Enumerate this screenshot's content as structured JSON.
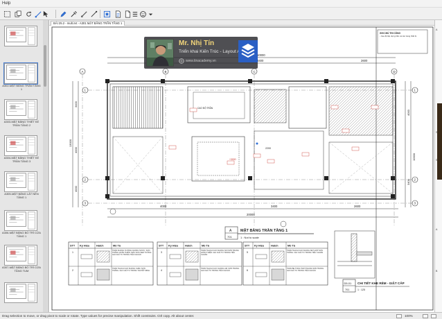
{
  "menubar": {
    "help": "Help"
  },
  "sidebar": {
    "thumbnails": [
      {
        "label": ""
      },
      {
        "label": "A302-MẶT BẰNG TRẦN TẦNG 1"
      },
      {
        "label": "A303-MẶT BẰNG THIẾT KẾ TRẦN TẦNG 2"
      },
      {
        "label": "A304-MẶT BẰNG THIẾT KẾ TRẦN TẦNG 3"
      },
      {
        "label": "A305-MẶT BẰNG LÁT NỀN TẦNG 1"
      },
      {
        "label": "A306-MẶT BẰNG BỐ TRÍ CỬA TẦNG 1"
      },
      {
        "label": "A307-MẶT BẰNG BỐ TRÍ CỬA TẦNG TUM"
      },
      {
        "label": ""
      }
    ]
  },
  "canvas": {
    "tab_label": "BẢI 25.2 - multi.rvt - A301 MẶT BẰNG TRẦN TẦNG 1",
    "view_title": "MẶT BẰNG TRẦN TẦNG 1",
    "view_number": "A",
    "view_sheet": "701",
    "view_scale": "1 : Not to scale",
    "detail_title": "CHI TIẾT KHE RÈM - GIẬT CẤP",
    "detail_number": "D5.01",
    "detail_sheet": "701",
    "detail_scale": "1 : 125",
    "note_title": "GHI CHÚ THI CÔNG",
    "note_text": "- Cao độ lắp dựng trần và các trang thiết bị",
    "dim_top": [
      "4000",
      "3400",
      "2600"
    ],
    "dim_top_overall": "10000",
    "dim_bottom": [
      "4000",
      "3400",
      "2600"
    ],
    "dim_bottom_overall": "20000",
    "dim_left": [
      "3400",
      "4000",
      "4000"
    ],
    "dim_left_overall": "13000",
    "dim_right": [
      "4000",
      "3400"
    ],
    "dim_right_overall": "10000",
    "grid_top": [
      "A",
      "B",
      "C",
      "D"
    ],
    "grid_left": [
      "1",
      "2",
      "3"
    ],
    "grid_right": [
      "1",
      "2",
      "3"
    ],
    "room_tags": [
      "CAO ĐỘ TRẦN",
      "2200",
      "+3000"
    ],
    "legend_tables": [
      {
        "headers": [
          "STT",
          "Ký Hiệu",
          "Hatch",
          "Mô Tả"
        ],
        "rows": [
          {
            "stt": "1",
            "desc": "TRẦN KHUNG XƯƠNG CHỐNG NƯỚC, SƠN TRẮNG HOÀN THIỆN. MÀU SƠN XEM TƯỜNG. GHI CHÚ TC TRONG TIÊU CHUẨN"
          },
          {
            "stt": "2",
            "desc": "TRẦN THẠCH CAO KHUNG CHÌM. SƠN TRẮNG. GHI CHÚ TC TRONG THUYẾT MINH"
          }
        ]
      },
      {
        "headers": [
          "STT",
          "Ký Hiệu",
          "Hatch",
          "Mô Tả"
        ],
        "rows": [
          {
            "stt": "3",
            "desc": "TRẦN THẠCH CAO KHUNG NỔI SƠN TRẮNG HOÀN THIỆN. GHI CHÚ TC TRONG TIÊU CHUẨN"
          },
          {
            "stt": "4",
            "desc": "TRẦN THẠCH CAO CHỐNG ẨM. SƠN TRẮNG. GHI CHÚ TC TRONG TIÊU CHUẨN"
          }
        ]
      },
      {
        "headers": [
          "STT",
          "Ký Hiệu",
          "Hatch",
          "Mô Tả"
        ],
        "rows": [
          {
            "stt": "5",
            "desc": "TRẦN THẠCH CAO KHUNG KẾT HỢP SƠN TRẮNG. GHI CHÚ TC TRONG TIÊU CHUẨN"
          },
          {
            "stt": "6",
            "desc": "TRẦN BÊ TÔNG TRÁT PHẲNG SƠN TRẮNG. GHI CHÚ TC TRONG TIÊU CHUẨN"
          }
        ]
      }
    ]
  },
  "banner": {
    "name": "Mr. Nhị Tín",
    "subtitle": "Triển khai Kiến Trúc - Layout Arc",
    "website": "www.tinacademy.vn"
  },
  "rightstrip": {
    "items": [
      "A",
      "S",
      "S",
      "A",
      "B"
    ]
  },
  "statusbar": {
    "message": "Drag selection to move, or drag pivot to scale or rotate. Type values for precise manipulation. Shift constrains. Ctrl copy. Alt about center.",
    "zoom": "100%"
  },
  "colors": {
    "accent": "#2f6fd6",
    "banner_name": "#f2d57a",
    "dim_red": "#c8322a"
  }
}
